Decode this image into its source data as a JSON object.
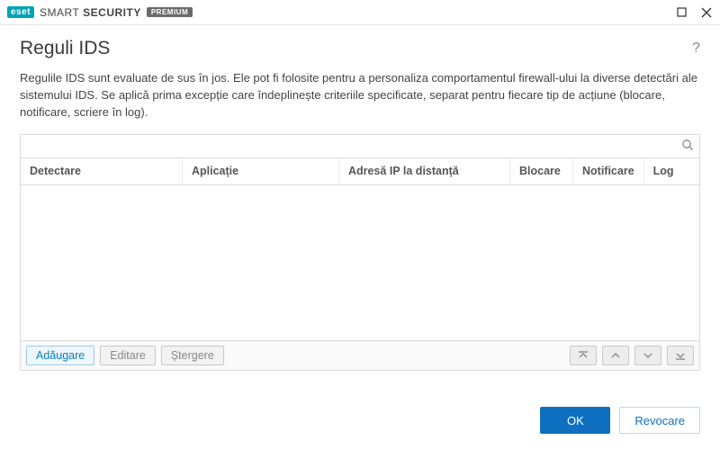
{
  "titlebar": {
    "logo_text": "eset",
    "product_light": "SMART",
    "product_bold": "SECURITY",
    "premium_badge": "PREMIUM"
  },
  "page": {
    "title": "Reguli IDS",
    "description": "Regulile IDS sunt evaluate de sus în jos. Ele pot fi folosite pentru a personaliza comportamentul firewall-ului la diverse detectări ale sistemului IDS. Se aplică prima excepție care îndeplinește criteriile specificate, separat pentru fiecare tip de acțiune (blocare, notificare, scriere în log)."
  },
  "table": {
    "search_placeholder": "",
    "columns": {
      "detect": "Detectare",
      "app": "Aplicație",
      "ip": "Adresă IP la distanță",
      "block": "Blocare",
      "notif": "Notificare",
      "log": "Log"
    },
    "rows": []
  },
  "table_actions": {
    "add": "Adăugare",
    "edit": "Editare",
    "delete": "Ștergere"
  },
  "footer": {
    "ok": "OK",
    "cancel": "Revocare"
  }
}
